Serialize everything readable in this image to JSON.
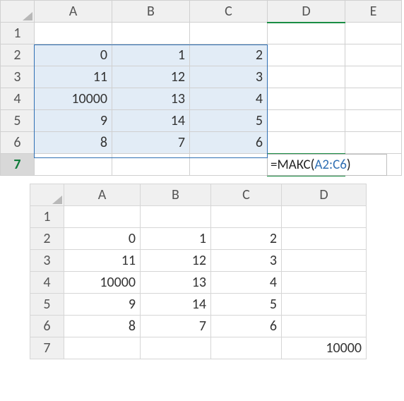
{
  "sheet1": {
    "columns": [
      "A",
      "B",
      "C",
      "D",
      "E"
    ],
    "rows": [
      "1",
      "2",
      "3",
      "4",
      "5",
      "6",
      "7"
    ],
    "cells": {
      "A2": "0",
      "B2": "1",
      "C2": "2",
      "A3": "11",
      "B3": "12",
      "C3": "3",
      "A4": "10000",
      "B4": "13",
      "C4": "4",
      "A5": "9",
      "B5": "14",
      "C5": "5",
      "A6": "8",
      "B6": "7",
      "C6": "6"
    },
    "formula": {
      "func": "=МАКС(",
      "ref": "A2:C6",
      "close": ")"
    },
    "active_row": "7",
    "active_col": "D"
  },
  "sheet2": {
    "columns": [
      "A",
      "B",
      "C",
      "D"
    ],
    "rows": [
      "1",
      "2",
      "3",
      "4",
      "5",
      "6",
      "7"
    ],
    "cells": {
      "A2": "0",
      "B2": "1",
      "C2": "2",
      "A3": "11",
      "B3": "12",
      "C3": "3",
      "A4": "10000",
      "B4": "13",
      "C4": "4",
      "A5": "9",
      "B5": "14",
      "C5": "5",
      "A6": "8",
      "B6": "7",
      "C6": "6",
      "D7": "10000"
    }
  },
  "chart_data": {
    "type": "table",
    "title": "Spreadsheet MAX function example",
    "input_range": "A2:C6",
    "data": [
      [
        0,
        1,
        2
      ],
      [
        11,
        12,
        3
      ],
      [
        10000,
        13,
        4
      ],
      [
        9,
        14,
        5
      ],
      [
        8,
        7,
        6
      ]
    ],
    "formula": "=МАКС(A2:C6)",
    "result": 10000
  }
}
